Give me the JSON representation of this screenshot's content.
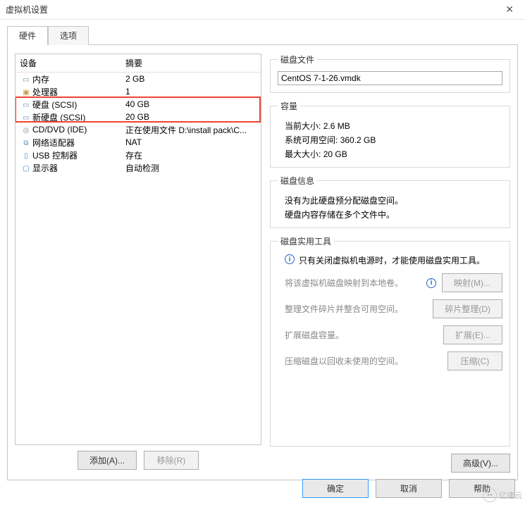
{
  "window": {
    "title": "虚拟机设置"
  },
  "tabs": {
    "hardware": "硬件",
    "options": "选项"
  },
  "device_table": {
    "header_device": "设备",
    "header_summary": "摘要"
  },
  "devices": [
    {
      "icon": "mem",
      "name": "内存",
      "summary": "2 GB"
    },
    {
      "icon": "cpu",
      "name": "处理器",
      "summary": "1"
    },
    {
      "icon": "hdd",
      "name": "硬盘 (SCSI)",
      "summary": "40 GB"
    },
    {
      "icon": "hdd",
      "name": "新硬盘 (SCSI)",
      "summary": "20 GB"
    },
    {
      "icon": "cd",
      "name": "CD/DVD (IDE)",
      "summary": "正在使用文件 D:\\install pack\\C..."
    },
    {
      "icon": "net",
      "name": "网络适配器",
      "summary": "NAT"
    },
    {
      "icon": "usb",
      "name": "USB 控制器",
      "summary": "存在"
    },
    {
      "icon": "disp",
      "name": "显示器",
      "summary": "自动检测"
    }
  ],
  "left_buttons": {
    "add": "添加(A)...",
    "remove": "移除(R)"
  },
  "right": {
    "disk_file": {
      "legend": "磁盘文件",
      "value": "CentOS 7-1-26.vmdk"
    },
    "capacity": {
      "legend": "容量",
      "current_label": "当前大小:",
      "current_value": "2.6 MB",
      "avail_label": "系统可用空间:",
      "avail_value": "360.2 GB",
      "max_label": "最大大小:",
      "max_value": "20 GB"
    },
    "disk_info": {
      "legend": "磁盘信息",
      "line1": "没有为此硬盘预分配磁盘空间。",
      "line2": "硬盘内容存储在多个文件中。"
    },
    "tools": {
      "legend": "磁盘实用工具",
      "note": "只有关闭虚拟机电源时，才能使用磁盘实用工具。",
      "map_desc": "将该虚拟机磁盘映射到本地卷。",
      "map_btn": "映射(M)...",
      "defrag_desc": "整理文件碎片并整合可用空间。",
      "defrag_btn": "碎片整理(D)",
      "expand_desc": "扩展磁盘容量。",
      "expand_btn": "扩展(E)...",
      "compress_desc": "压缩磁盘以回收未使用的空间。",
      "compress_btn": "压缩(C)"
    },
    "advanced": "高级(V)..."
  },
  "footer": {
    "ok": "确定",
    "cancel": "取消",
    "help": "帮助"
  },
  "watermark": "亿速云"
}
